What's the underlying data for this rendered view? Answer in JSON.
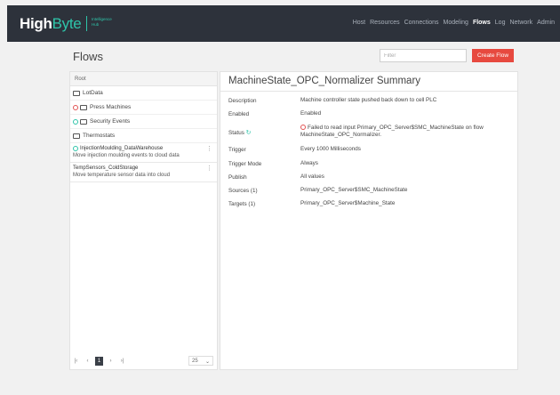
{
  "brand": {
    "name_a": "High",
    "name_b": "Byte",
    "sub_1": "Intelligence",
    "sub_2": "Hub"
  },
  "nav": [
    "Host",
    "Resources",
    "Connections",
    "Modeling",
    "Flows",
    "Log",
    "Network",
    "Admin"
  ],
  "nav_active": "Flows",
  "page": {
    "title": "Flows",
    "filter_placeholder": "Filter",
    "create_label": "Create Flow"
  },
  "tree": {
    "root": "Root",
    "folders": [
      {
        "label": "LotData",
        "status": ""
      },
      {
        "label": "Press Machines",
        "status": "error"
      },
      {
        "label": "Security Events",
        "status": "ok"
      },
      {
        "label": "Thermostats",
        "status": ""
      }
    ],
    "flows": [
      {
        "name": "InjectionMoulding_DataWarehouse",
        "desc": "Move injection moulding events to cloud data",
        "status": "ok"
      },
      {
        "name": "TempSensors_ColdStorage",
        "desc": "Move temperature sensor data into cloud",
        "status": ""
      }
    ]
  },
  "pager": {
    "first": "|‹",
    "prev": "‹",
    "current": "1",
    "next": "›",
    "last": "›|",
    "page_size": "25"
  },
  "summary": {
    "title": "MachineState_OPC_Normalizer Summary",
    "rows": [
      {
        "label": "Description",
        "value": "Machine controller state pushed back down to cell PLC"
      },
      {
        "label": "Enabled",
        "value": "Enabled"
      },
      {
        "label": "Status",
        "value": "Failed to read input Primary_OPC_Server$SMC_MachineState on flow MachineState_OPC_Normalizer."
      },
      {
        "label": "Trigger",
        "value": "Every 1000 Milliseconds"
      },
      {
        "label": "Trigger Mode",
        "value": "Always"
      },
      {
        "label": "Publish",
        "value": "All values"
      },
      {
        "label": "Sources (1)",
        "value": "Primary_OPC_Server$SMC_MachineState"
      },
      {
        "label": "Targets (1)",
        "value": "Primary_OPC_Server$Machine_State"
      }
    ]
  }
}
